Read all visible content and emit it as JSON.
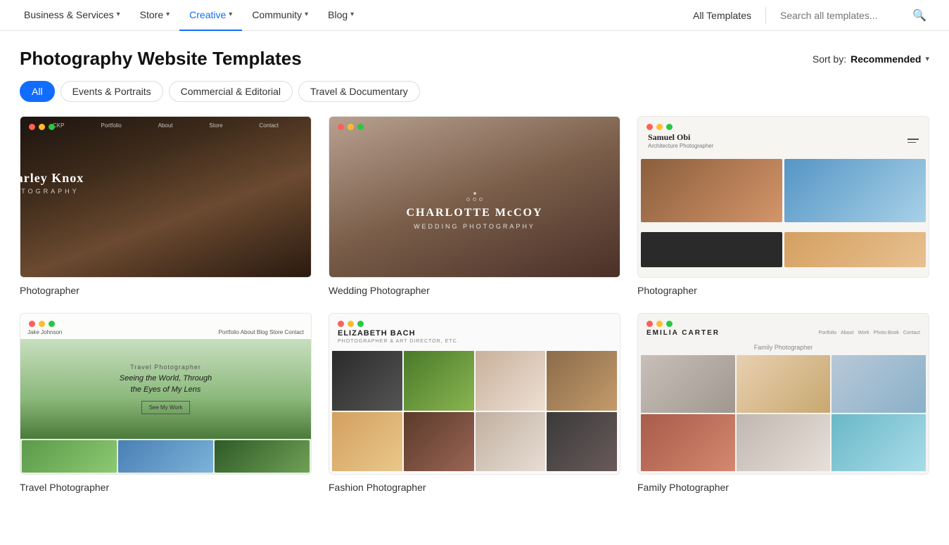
{
  "nav": {
    "items": [
      {
        "id": "business-services",
        "label": "Business & Services",
        "hasChevron": true,
        "active": false
      },
      {
        "id": "store",
        "label": "Store",
        "hasChevron": true,
        "active": false
      },
      {
        "id": "creative",
        "label": "Creative",
        "hasChevron": true,
        "active": true
      },
      {
        "id": "community",
        "label": "Community",
        "hasChevron": true,
        "active": false
      },
      {
        "id": "blog",
        "label": "Blog",
        "hasChevron": true,
        "active": false
      }
    ],
    "all_templates": "All Templates",
    "search_placeholder": "Search all templates..."
  },
  "page": {
    "title": "Photography Website Templates",
    "sort_by_label": "Sort by:",
    "sort_value": "Recommended"
  },
  "filters": [
    {
      "id": "all",
      "label": "All",
      "selected": true
    },
    {
      "id": "events-portraits",
      "label": "Events & Portraits",
      "selected": false
    },
    {
      "id": "commercial-editorial",
      "label": "Commercial & Editorial",
      "selected": false
    },
    {
      "id": "travel-documentary",
      "label": "Travel & Documentary",
      "selected": false
    }
  ],
  "templates": [
    {
      "id": "charley-knox",
      "name": "Photographer",
      "title": "Charley Knox",
      "subtitle": "PHOTOGRAPHY",
      "row": 1
    },
    {
      "id": "charlotte-mccoy",
      "name": "Wedding Photographer",
      "title": "CHARLOTTE McCOY",
      "subtitle": "WEDDING PHOTOGRAPHY",
      "row": 1
    },
    {
      "id": "samuel-obi",
      "name": "Photographer",
      "title": "Samuel Obi",
      "subtitle": "Architecture Photographer",
      "row": 1
    },
    {
      "id": "jake-johnson",
      "name": "Travel Photographer",
      "tagline": "Seeing the World, Through the Eyes of My Lens",
      "row": 2
    },
    {
      "id": "elizabeth-bach",
      "name": "Fashion Photographer",
      "title": "ELIZABETH BACH",
      "subtitle": "PHOTOGRAPHER & ART DIRECTOR, ETC.",
      "row": 2
    },
    {
      "id": "emilia-carter",
      "name": "Family Photographer",
      "title": "EMILIA CARTER",
      "subtitle": "Family Photographer",
      "row": 2
    }
  ]
}
